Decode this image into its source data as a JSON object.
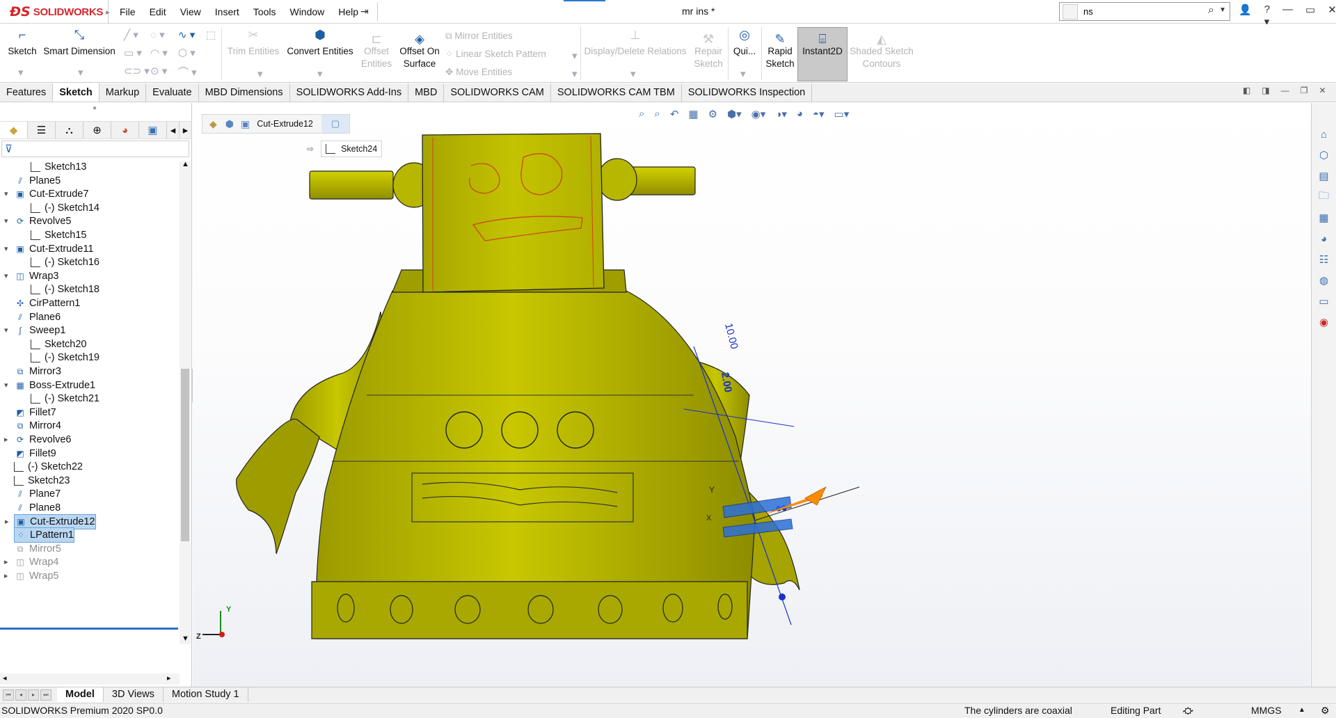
{
  "app": {
    "brand": "SOLIDWORKS",
    "doc_title": "mr ins *"
  },
  "menu": [
    "File",
    "Edit",
    "View",
    "Insert",
    "Tools",
    "Window",
    "Help"
  ],
  "search": {
    "value": "ns"
  },
  "toolbar": {
    "sketch": "Sketch",
    "smart_dimension": "Smart Dimension",
    "trim_entities": "Trim Entities",
    "convert_entities": "Convert Entities",
    "offset_entities_1": "Offset",
    "offset_entities_2": "Entities",
    "offset_on_surface_1": "Offset On",
    "offset_on_surface_2": "Surface",
    "mirror_entities": "Mirror Entities",
    "linear_sketch_pattern": "Linear Sketch Pattern",
    "move_entities": "Move Entities",
    "display_delete_relations": "Display/Delete Relations",
    "repair_sketch_1": "Repair",
    "repair_sketch_2": "Sketch",
    "quick_snaps": "Qui...",
    "rapid_sketch_1": "Rapid",
    "rapid_sketch_2": "Sketch",
    "instant2d": "Instant2D",
    "shaded_sketch_1": "Shaded Sketch",
    "shaded_sketch_2": "Contours"
  },
  "tabs": [
    "Features",
    "Sketch",
    "Markup",
    "Evaluate",
    "MBD Dimensions",
    "SOLIDWORKS Add-Ins",
    "MBD",
    "SOLIDWORKS CAM",
    "SOLIDWORKS CAM TBM",
    "SOLIDWORKS Inspection"
  ],
  "active_tab": "Sketch",
  "tree": [
    {
      "label": "Sketch13",
      "icon": "sketch-icon",
      "level": 2
    },
    {
      "label": "Plane5",
      "icon": "plane-icon",
      "level": 1
    },
    {
      "label": "Cut-Extrude7",
      "icon": "cut-extrude-icon",
      "level": 1,
      "expanded": true
    },
    {
      "label": "(-) Sketch14",
      "icon": "sketch-icon",
      "level": 2
    },
    {
      "label": "Revolve5",
      "icon": "revolve-icon",
      "level": 1,
      "expanded": true
    },
    {
      "label": "Sketch15",
      "icon": "sketch-icon",
      "level": 2
    },
    {
      "label": "Cut-Extrude11",
      "icon": "cut-extrude-icon",
      "level": 1,
      "expanded": true
    },
    {
      "label": "(-) Sketch16",
      "icon": "sketch-icon",
      "level": 2
    },
    {
      "label": "Wrap3",
      "icon": "wrap-icon",
      "level": 1,
      "expanded": true
    },
    {
      "label": "(-) Sketch18",
      "icon": "sketch-icon",
      "level": 2
    },
    {
      "label": "CirPattern1",
      "icon": "circular-pattern-icon",
      "level": 1
    },
    {
      "label": "Plane6",
      "icon": "plane-icon",
      "level": 1
    },
    {
      "label": "Sweep1",
      "icon": "sweep-icon",
      "level": 1,
      "expanded": true
    },
    {
      "label": "Sketch20",
      "icon": "sketch-icon",
      "level": 2
    },
    {
      "label": "(-) Sketch19",
      "icon": "sketch-icon",
      "level": 2
    },
    {
      "label": "Mirror3",
      "icon": "mirror-icon",
      "level": 1
    },
    {
      "label": "Boss-Extrude1",
      "icon": "boss-extrude-icon",
      "level": 1,
      "expanded": true
    },
    {
      "label": "(-) Sketch21",
      "icon": "sketch-icon",
      "level": 2
    },
    {
      "label": "Fillet7",
      "icon": "fillet-icon",
      "level": 1
    },
    {
      "label": "Mirror4",
      "icon": "mirror-icon",
      "level": 1
    },
    {
      "label": "Revolve6",
      "icon": "revolve-icon",
      "level": 1,
      "collapsed": true
    },
    {
      "label": "Fillet9",
      "icon": "fillet-icon",
      "level": 1
    },
    {
      "label": "(-) Sketch22",
      "icon": "sketch-icon",
      "level": 1
    },
    {
      "label": "Sketch23",
      "icon": "sketch-icon",
      "level": 1
    },
    {
      "label": "Plane7",
      "icon": "plane-icon",
      "level": 1
    },
    {
      "label": "Plane8",
      "icon": "plane-icon",
      "level": 1
    },
    {
      "label": "Cut-Extrude12",
      "icon": "cut-extrude-icon",
      "level": 1,
      "collapsed": true,
      "selected": true
    },
    {
      "label": "LPattern1",
      "icon": "linear-pattern-icon",
      "level": 1,
      "selected": true
    },
    {
      "label": "Mirror5",
      "icon": "mirror-icon",
      "level": 1,
      "suppressed": true
    },
    {
      "label": "Wrap4",
      "icon": "wrap-icon",
      "level": 1,
      "collapsed": true,
      "suppressed": true
    },
    {
      "label": "Wrap5",
      "icon": "wrap-icon",
      "level": 1,
      "collapsed": true,
      "suppressed": true
    }
  ],
  "breadcrumb": {
    "feature": "Cut-Extrude12",
    "sketch": "Sketch24"
  },
  "dimensions": {
    "d1": "10.00",
    "d2": "2.00"
  },
  "triad": {
    "y": "Y",
    "z": "Z"
  },
  "bottom_tabs": [
    "Model",
    "3D Views",
    "Motion Study 1"
  ],
  "active_bottom_tab": "Model",
  "status": {
    "product": "SOLIDWORKS Premium 2020 SP0.0",
    "message": "The cylinders are coaxial",
    "mode": "Editing Part",
    "units": "MMGS"
  },
  "colors": {
    "model": "#b5b400",
    "model_dark": "#7a7a00",
    "accent": "#2b78d0",
    "brand": "#d4262c"
  }
}
